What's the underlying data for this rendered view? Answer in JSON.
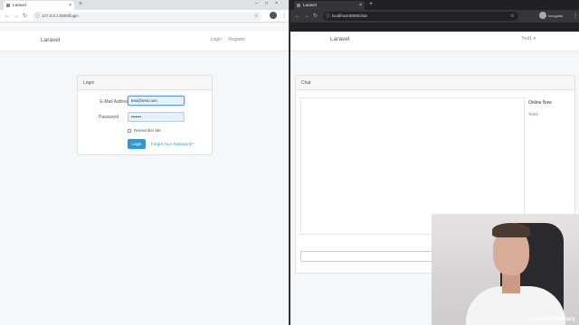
{
  "left_browser": {
    "tab_title": "Laravel",
    "url": "127.0.0.1:8000/login",
    "nav_brand": "Laravel",
    "nav_links": [
      "Login",
      "Register"
    ],
    "login": {
      "header": "Login",
      "email_label": "E-Mail Address",
      "email_value": "test@test.com",
      "password_label": "Password",
      "password_value": "•••••••",
      "remember_label": "Remember Me",
      "login_button": "Login",
      "forgot_link": "Forgot Your Password?"
    }
  },
  "right_browser": {
    "tab_title": "Laravel",
    "url": "localhost:8000/chat",
    "incognito_label": "Incognito",
    "nav_brand": "Laravel",
    "user_menu": "Test1",
    "chat": {
      "header": "Chat",
      "online_header": "Online Now",
      "online_users": [
        "Test1"
      ]
    }
  },
  "webcam": {
    "watermark": "CodeWithDary"
  },
  "icons": {
    "back": "arrow-left-icon",
    "forward": "arrow-right-icon",
    "reload": "reload-icon",
    "star": "star-icon",
    "menu": "kebab-menu-icon"
  }
}
